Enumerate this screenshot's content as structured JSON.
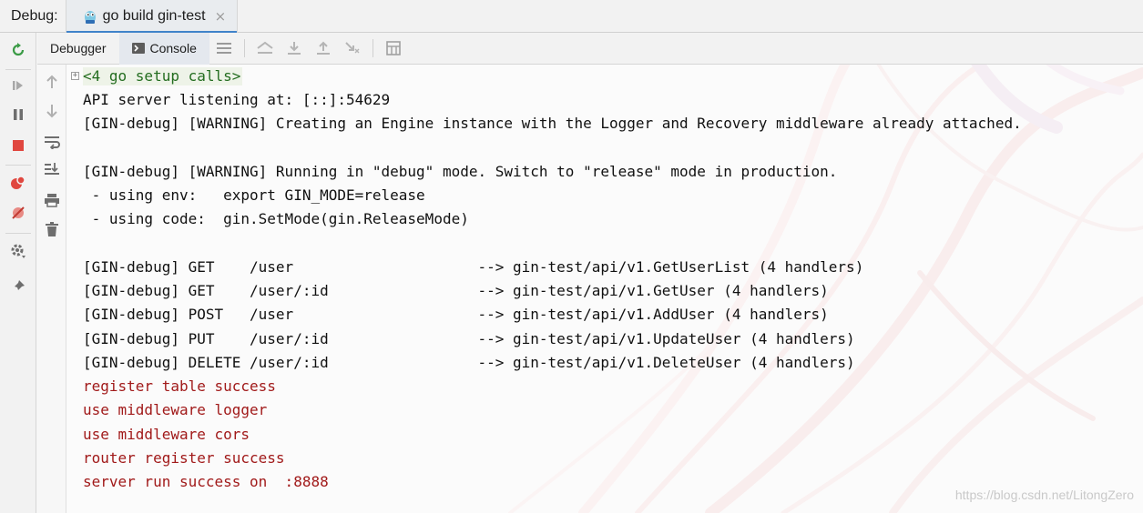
{
  "tabbar": {
    "debug_label": "Debug:",
    "tab_title": "go build gin-test",
    "close_glyph": "×"
  },
  "subbar": {
    "debugger_label": "Debugger",
    "console_label": "Console"
  },
  "console": {
    "fold_glyph": "+",
    "setup_calls": "<4 go setup calls>",
    "lines": [
      "API server listening at: [::]:54629",
      "[GIN-debug] [WARNING] Creating an Engine instance with the Logger and Recovery middleware already attached.",
      "",
      "[GIN-debug] [WARNING] Running in \"debug\" mode. Switch to \"release\" mode in production.",
      " - using env:   export GIN_MODE=release",
      " - using code:  gin.SetMode(gin.ReleaseMode)",
      "",
      "[GIN-debug] GET    /user                     --> gin-test/api/v1.GetUserList (4 handlers)",
      "[GIN-debug] GET    /user/:id                 --> gin-test/api/v1.GetUser (4 handlers)",
      "[GIN-debug] POST   /user                     --> gin-test/api/v1.AddUser (4 handlers)",
      "[GIN-debug] PUT    /user/:id                 --> gin-test/api/v1.UpdateUser (4 handlers)",
      "[GIN-debug] DELETE /user/:id                 --> gin-test/api/v1.DeleteUser (4 handlers)"
    ],
    "app_lines": [
      "register table success",
      "use middleware logger",
      "use middleware cors",
      "router register success",
      "server run success on  :8888"
    ]
  },
  "watermark": "https://blog.csdn.net/LitongZero",
  "colors": {
    "accent": "#4083c9",
    "app_output": "#a11a1a",
    "stop": "#e0473f",
    "rerun": "#3b9b46"
  },
  "icons": {
    "leftbar": [
      "rerun-icon",
      "resume-icon",
      "pause-icon",
      "stop-icon",
      "view-breakpoints-icon",
      "mute-breakpoints-icon",
      "settings-icon",
      "pin-icon"
    ],
    "subbar": [
      "console-icon",
      "menu-icon",
      "show-execution-point-icon",
      "step-over-icon",
      "step-into-icon",
      "step-out-icon",
      "run-to-cursor-icon",
      "evaluate-expression-icon"
    ],
    "gutter": [
      "up-arrow-icon",
      "down-arrow-icon",
      "soft-wrap-icon",
      "scroll-to-end-icon",
      "print-icon",
      "trash-icon"
    ]
  }
}
